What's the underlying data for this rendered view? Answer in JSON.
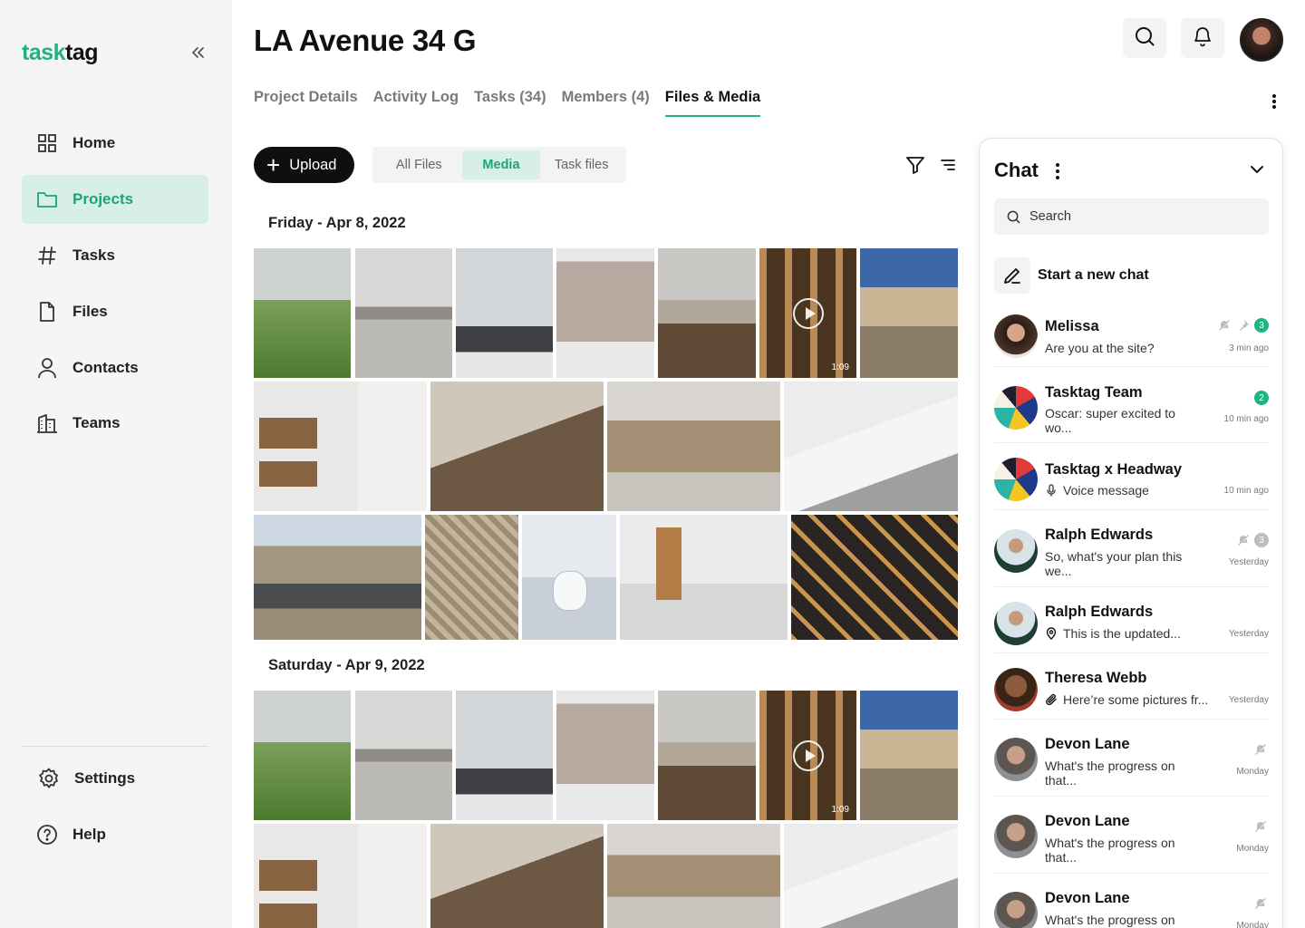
{
  "app": {
    "logo_part1": "task",
    "logo_part2": "tag",
    "accent": "#1db385"
  },
  "sidebar": {
    "items": [
      {
        "label": "Home",
        "icon": "grid-icon"
      },
      {
        "label": "Projects",
        "icon": "folder-icon"
      },
      {
        "label": "Tasks",
        "icon": "hash-icon"
      },
      {
        "label": "Files",
        "icon": "file-icon"
      },
      {
        "label": "Contacts",
        "icon": "user-icon"
      },
      {
        "label": "Teams",
        "icon": "building-icon"
      }
    ],
    "bottom": [
      {
        "label": "Settings",
        "icon": "gear-icon"
      },
      {
        "label": "Help",
        "icon": "help-icon"
      }
    ]
  },
  "header": {
    "title": "LA Avenue 34 G"
  },
  "tabs": [
    {
      "label": "Project Details"
    },
    {
      "label": "Activity Log"
    },
    {
      "label": "Tasks (34)"
    },
    {
      "label": "Members (4)"
    },
    {
      "label": "Files & Media",
      "active": true
    }
  ],
  "toolbar": {
    "upload_label": "Upload",
    "filters": [
      "All Files",
      "Media",
      "Task files"
    ],
    "selected_filter": "Media"
  },
  "gallery": {
    "groups": [
      {
        "date": "Friday - Apr 8, 2022"
      },
      {
        "date": "Saturday - Apr 9, 2022"
      }
    ],
    "video_duration": "1:09"
  },
  "chat": {
    "title": "Chat",
    "search_placeholder": "Search",
    "new_chat_label": "Start a new chat",
    "conversations": [
      {
        "name": "Melissa",
        "message": "Are you at the site?",
        "time": "3 min ago",
        "badge": "3",
        "muted": true,
        "pinned": true
      },
      {
        "name": "Tasktag Team",
        "message": "Oscar: super excited to wo...",
        "time": "10 min ago",
        "badge": "2"
      },
      {
        "name": "Tasktag x Headway",
        "message": "Voice message",
        "time": "10 min ago",
        "msg_icon": "mic-icon"
      },
      {
        "name": "Ralph Edwards",
        "message": "So, what's your plan this we...",
        "time": "Yesterday",
        "badge": "3",
        "muted": true
      },
      {
        "name": "Ralph Edwards",
        "message": "This is the updated...",
        "time": "Yesterday",
        "msg_icon": "location-icon"
      },
      {
        "name": "Theresa Webb",
        "message": "Here’re some pictures fr...",
        "time": "Yesterday",
        "msg_icon": "paperclip-icon"
      },
      {
        "name": "Devon Lane",
        "message": "What's the progress on that...",
        "time": "Monday",
        "muted": true
      },
      {
        "name": "Devon Lane",
        "message": "What's the progress on that...",
        "time": "Monday",
        "muted": true
      },
      {
        "name": "Devon Lane",
        "message": "What's the progress on",
        "time": "Monday",
        "muted": true
      }
    ]
  }
}
